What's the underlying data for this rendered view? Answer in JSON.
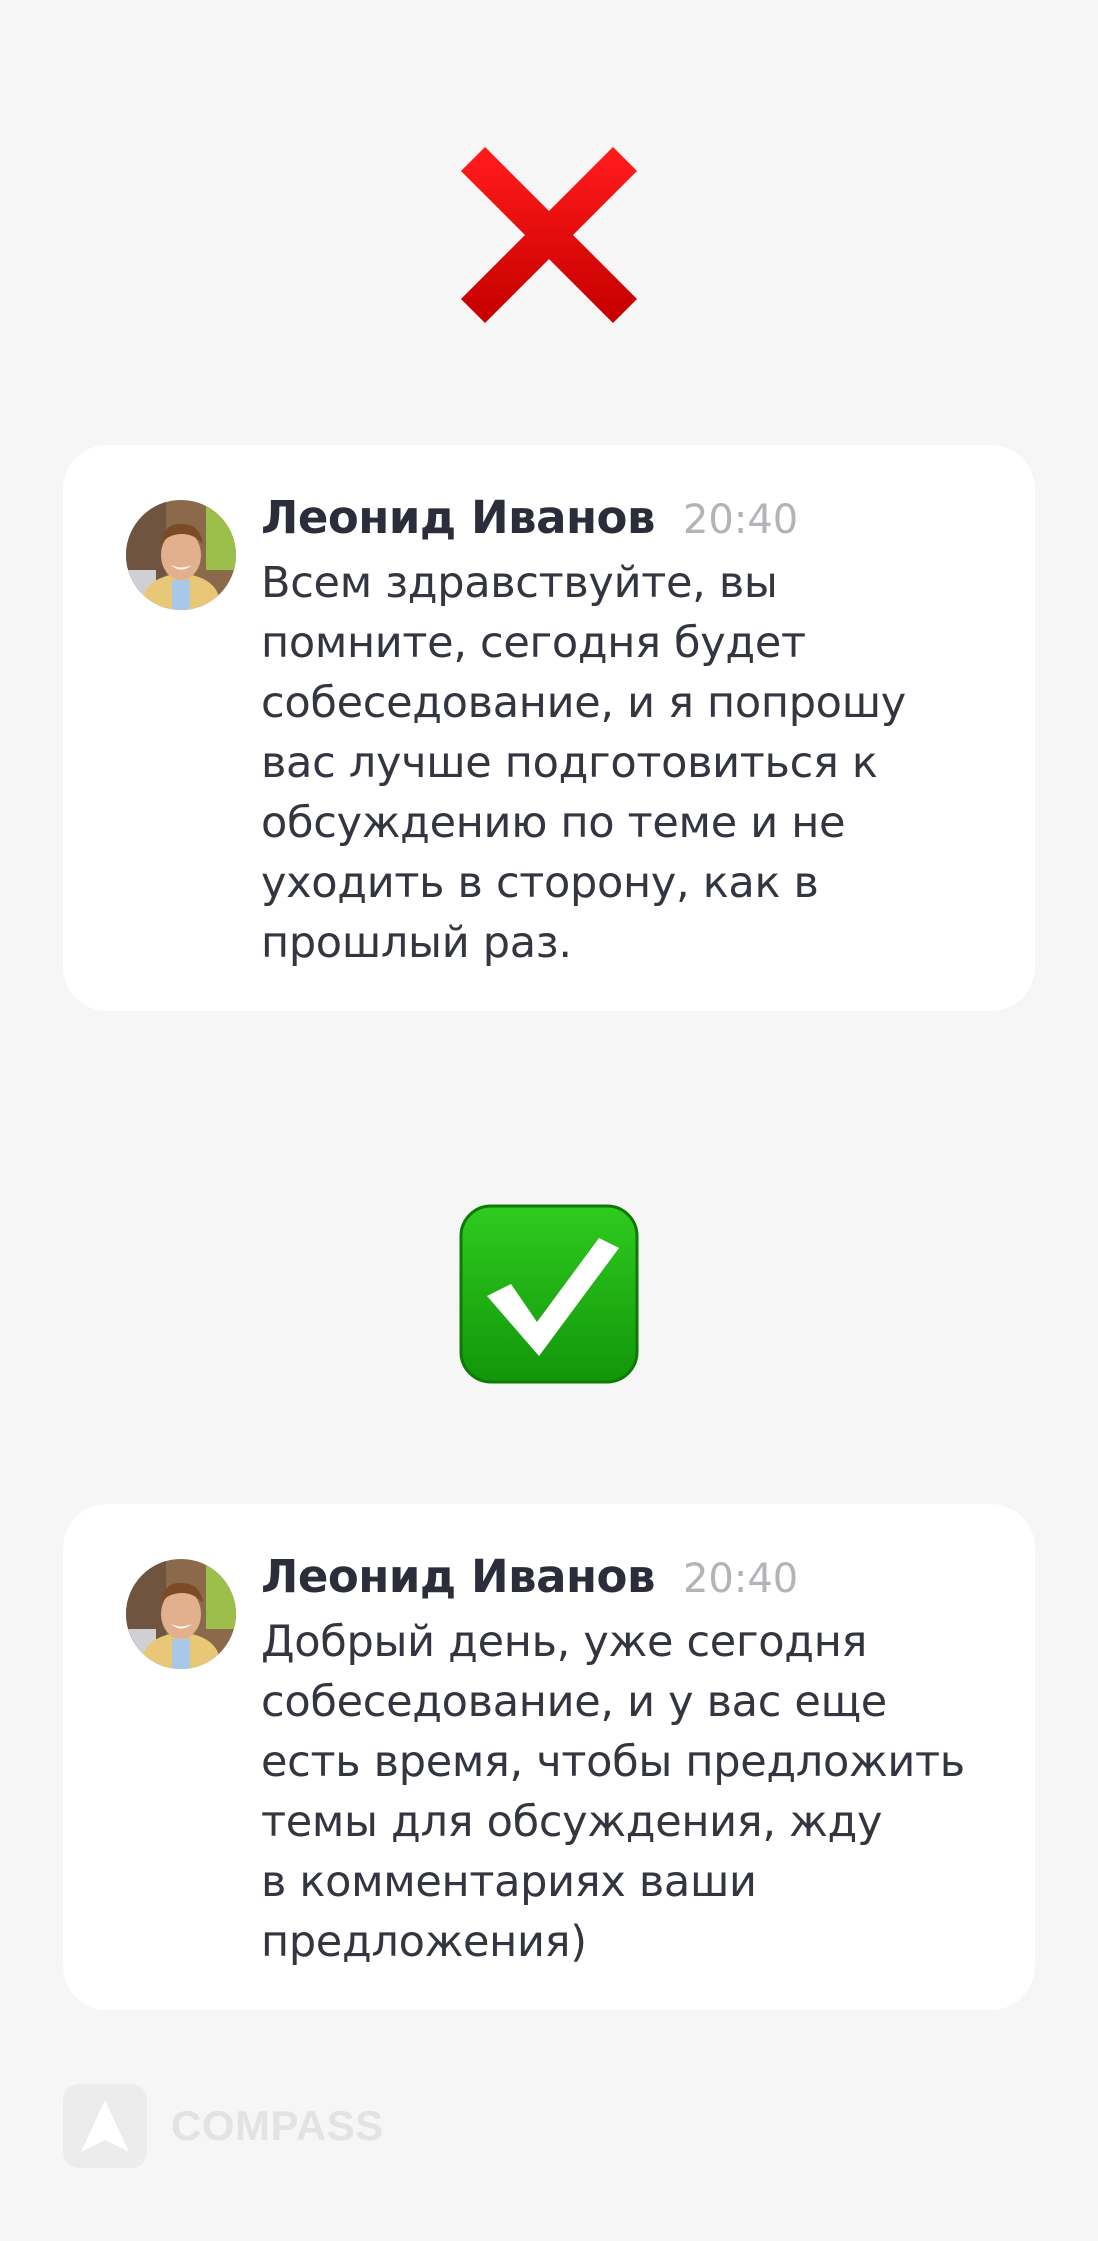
{
  "bad_example": {
    "icon": "red-cross-mark-icon",
    "icon_color": "#e00000",
    "message": {
      "author": "Леонид Иванов",
      "time": "20:40",
      "text": "Всем здравствуйте, вы\nпомните, сегодня будет\nсобеседование, и я попрошу\nвас лучше подготовиться к\nобсуждению по теме и не\nуходить в сторону, как в\nпрошлый раз."
    }
  },
  "good_example": {
    "icon": "green-check-mark-icon",
    "icon_color": "#22b014",
    "message": {
      "author": "Леонид Иванов",
      "time": "20:40",
      "text": "Добрый день, уже сегодня\nсобеседование, и у вас еще\nесть время, чтобы предложить\nтемы для обсуждения, жду\nв комментариях ваши\nпредложения)"
    }
  },
  "footer": {
    "logo_text": "COMPASS",
    "logo_icon": "compass-logo-icon"
  }
}
